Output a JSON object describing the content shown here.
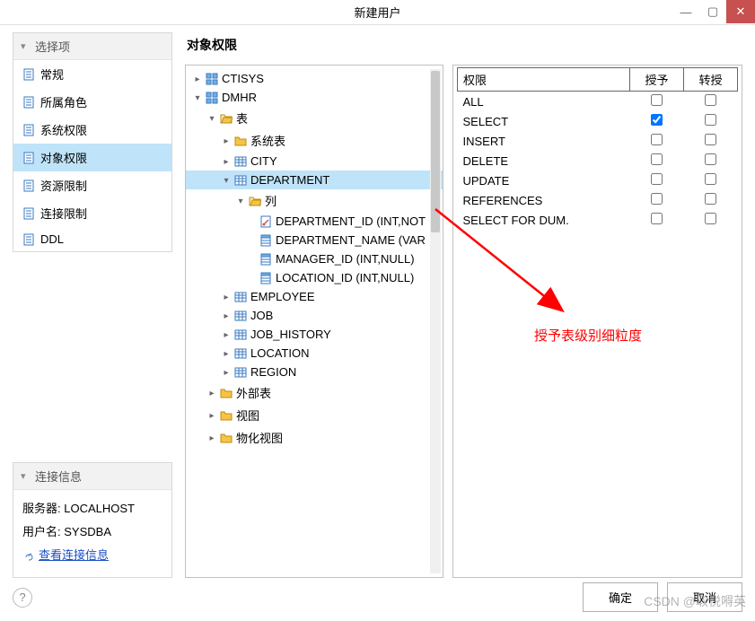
{
  "titlebar": {
    "title": "新建用户"
  },
  "sidebar": {
    "panel_title": "选择项",
    "items": [
      {
        "label": "常规"
      },
      {
        "label": "所属角色"
      },
      {
        "label": "系统权限"
      },
      {
        "label": "对象权限",
        "selected": true
      },
      {
        "label": "资源限制"
      },
      {
        "label": "连接限制"
      },
      {
        "label": "DDL"
      }
    ]
  },
  "conn": {
    "panel_title": "连接信息",
    "server_label": "服务器:",
    "server_value": "LOCALHOST",
    "user_label": "用户名:",
    "user_value": "SYSDBA",
    "link": "查看连接信息"
  },
  "main": {
    "title": "对象权限"
  },
  "tree": {
    "ctisys": "CTISYS",
    "dmhr": "DMHR",
    "tables": "表",
    "systables": "系统表",
    "city": "CITY",
    "department": "DEPARTMENT",
    "cols": "列",
    "dept_id": "DEPARTMENT_ID (INT,NOT",
    "dept_name": "DEPARTMENT_NAME (VAR",
    "mgr_id": "MANAGER_ID (INT,NULL)",
    "loc_id": "LOCATION_ID (INT,NULL)",
    "employee": "EMPLOYEE",
    "job": "JOB",
    "job_history": "JOB_HISTORY",
    "location": "LOCATION",
    "region": "REGION",
    "ext_tables": "外部表",
    "views": "视图",
    "mat_views": "物化视图"
  },
  "perm": {
    "head_name": "权限",
    "head_grant": "授予",
    "head_trans": "转授",
    "rows": [
      {
        "name": "ALL",
        "grant": false,
        "trans": false
      },
      {
        "name": "SELECT",
        "grant": true,
        "trans": false
      },
      {
        "name": "INSERT",
        "grant": false,
        "trans": false
      },
      {
        "name": "DELETE",
        "grant": false,
        "trans": false
      },
      {
        "name": "UPDATE",
        "grant": false,
        "trans": false
      },
      {
        "name": "REFERENCES",
        "grant": false,
        "trans": false
      },
      {
        "name": "SELECT FOR DUM.",
        "grant": false,
        "trans": false
      }
    ]
  },
  "annotation": "授予表级别细粒度",
  "footer": {
    "ok": "确定",
    "cancel": "取消"
  },
  "watermark": "CSDN @取悦嘚英"
}
